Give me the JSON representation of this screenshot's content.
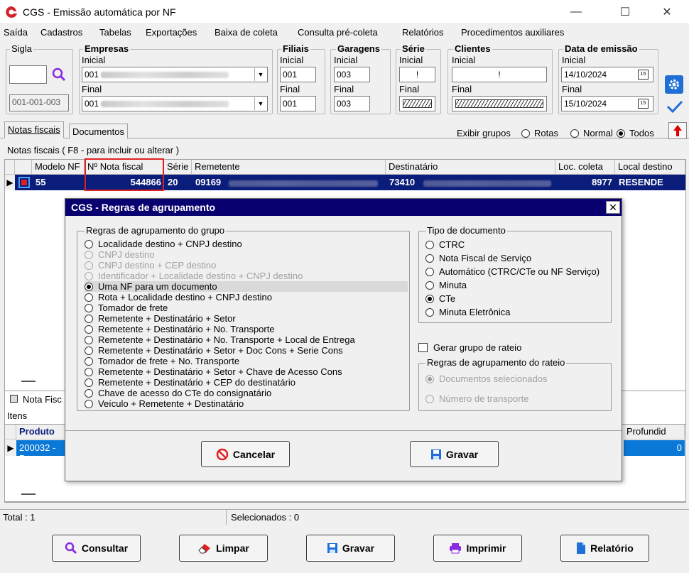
{
  "window": {
    "title": "CGS - Emissão automática por NF",
    "minimize": "—",
    "maximize": "☐",
    "close": "✕"
  },
  "menu": [
    "Saída",
    "Cadastros",
    "Tabelas",
    "Exportações",
    "Baixa de coleta",
    "Consulta pré-coleta",
    "Relatórios",
    "Procedimentos auxiliares"
  ],
  "filters": {
    "sigla": {
      "legend": "Sigla",
      "value": "",
      "code": "001-001-003"
    },
    "empresas": {
      "legend": "Empresas",
      "inicial_label": "Inicial",
      "inicial_value": "001",
      "final_label": "Final",
      "final_value": "001"
    },
    "filiais": {
      "legend": "Filiais",
      "inicial_label": "Inicial",
      "inicial_value": "001",
      "final_label": "Final",
      "final_value": "001"
    },
    "garagens": {
      "legend": "Garagens",
      "inicial_label": "Inicial",
      "inicial_value": "003",
      "final_label": "Final",
      "final_value": "003"
    },
    "serie": {
      "legend": "Série",
      "inicial_label": "Inicial",
      "inicial_value": "!",
      "final_label": "Final",
      "final_value": ""
    },
    "clientes": {
      "legend": "Clientes",
      "inicial_label": "Inicial",
      "inicial_value": "!",
      "final_label": "Final",
      "final_value": ""
    },
    "data_emissao": {
      "legend": "Data de emissão",
      "inicial_label": "Inicial",
      "inicial_value": "14/10/2024",
      "final_label": "Final",
      "final_value": "15/10/2024",
      "cal_icon": "15"
    }
  },
  "tabs": [
    "Notas fiscais",
    "Documentos"
  ],
  "exibir_grupos": {
    "label": "Exibir grupos",
    "options": [
      "Rotas",
      "Normal",
      "Todos"
    ],
    "selected": "Todos"
  },
  "notas": {
    "caption": "Notas fiscais ( F8 - para incluir ou alterar )",
    "columns": [
      "Modelo NF",
      "Nº Nota fiscal",
      "Série",
      "Remetente",
      "Destinatário",
      "Loc. coleta",
      "Local destino"
    ],
    "rows": [
      {
        "modelo": "55",
        "nota": "544866",
        "serie": "20",
        "remetente": "09169",
        "destinatario": "73410",
        "loc_coleta": "8977",
        "local_destino": "RESENDE"
      }
    ]
  },
  "lower": {
    "tab": "Nota Fisc",
    "itens_label": "Itens",
    "col_produto": "Produto",
    "col_profundidade": "Profundid",
    "row_produto": "200032 - D",
    "row_prof": "0"
  },
  "status": {
    "total": "Total : 1",
    "selecionados": "Selecionados : 0"
  },
  "buttons": {
    "consultar": "Consultar",
    "limpar": "Limpar",
    "gravar": "Gravar",
    "imprimir": "Imprimir",
    "relatorio": "Relatório"
  },
  "dialog": {
    "title": "CGS - Regras de agrupamento",
    "close": "✕",
    "rules_legend": "Regras de agrupamento do grupo",
    "rules": [
      {
        "label": "Localidade destino + CNPJ destino",
        "disabled": false,
        "selected": false
      },
      {
        "label": "CNPJ destino",
        "disabled": true,
        "selected": false
      },
      {
        "label": "CNPJ destino + CEP destino",
        "disabled": true,
        "selected": false
      },
      {
        "label": "Identificador + Localidade destino + CNPJ destino",
        "disabled": true,
        "selected": false
      },
      {
        "label": "Uma NF para um documento",
        "disabled": false,
        "selected": true
      },
      {
        "label": "Rota + Localidade destino + CNPJ destino",
        "disabled": false,
        "selected": false
      },
      {
        "label": "Tomador de frete",
        "disabled": false,
        "selected": false
      },
      {
        "label": "Remetente + Destinatário + Setor",
        "disabled": false,
        "selected": false
      },
      {
        "label": "Remetente + Destinatário + No. Transporte",
        "disabled": false,
        "selected": false
      },
      {
        "label": "Remetente + Destinatário + No. Transporte + Local de Entrega",
        "disabled": false,
        "selected": false
      },
      {
        "label": "Remetente + Destinatário + Setor + Doc Cons + Serie Cons",
        "disabled": false,
        "selected": false
      },
      {
        "label": "Tomador de frete + No. Transporte",
        "disabled": false,
        "selected": false
      },
      {
        "label": "Remetente + Destinatário + Setor + Chave de Acesso Cons",
        "disabled": false,
        "selected": false
      },
      {
        "label": "Remetente + Destinatário + CEP do destinatário",
        "disabled": false,
        "selected": false
      },
      {
        "label": "Chave de acesso do CTe do consignatário",
        "disabled": false,
        "selected": false
      },
      {
        "label": "Veículo + Remetente + Destinatário",
        "disabled": false,
        "selected": false
      }
    ],
    "tipo_legend": "Tipo de documento",
    "tipos": [
      {
        "label": "CTRC",
        "selected": false
      },
      {
        "label": "Nota Fiscal de Serviço",
        "selected": false
      },
      {
        "label": "Automático (CTRC/CTe ou NF Serviço)",
        "selected": false
      },
      {
        "label": "Minuta",
        "selected": false
      },
      {
        "label": "CTe",
        "selected": true
      },
      {
        "label": "Minuta Eletrônica",
        "selected": false
      }
    ],
    "gerar_rateio": "Gerar grupo de rateio",
    "rateio_legend": "Regras de agrupamento do rateio",
    "rateio_opts": [
      {
        "label": "Documentos selecionados",
        "selected": true
      },
      {
        "label": "Número de transporte",
        "selected": false
      }
    ],
    "cancelar": "Cancelar",
    "gravar": "Gravar"
  }
}
